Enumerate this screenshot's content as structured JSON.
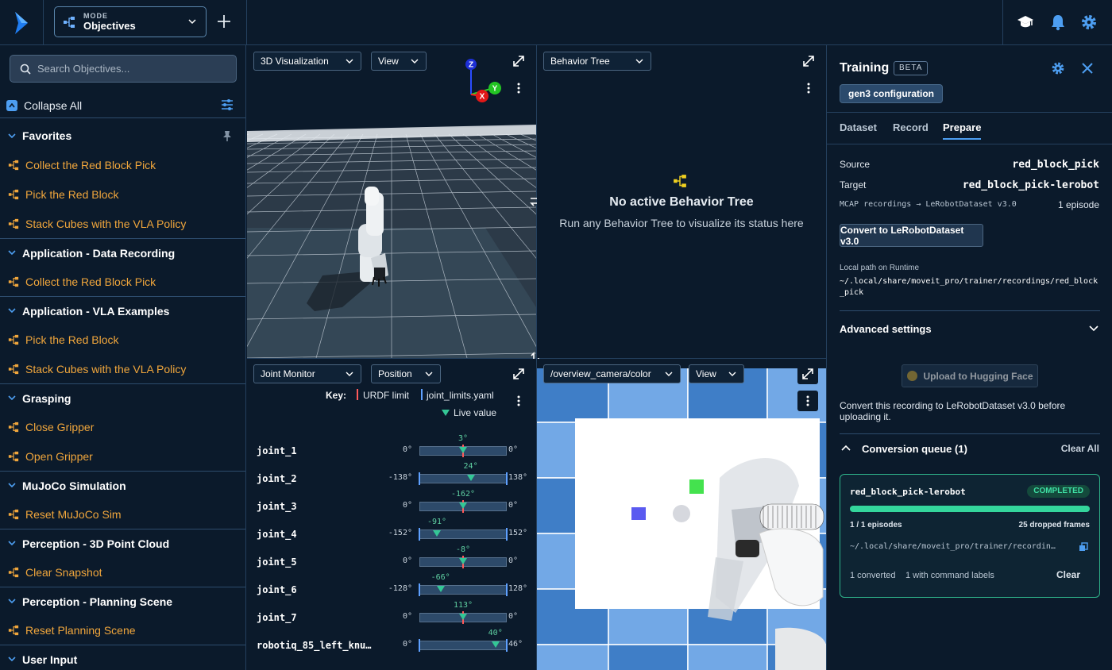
{
  "topbar": {
    "mode_label": "MODE",
    "mode_value": "Objectives"
  },
  "sidebar": {
    "search_placeholder": "Search Objectives...",
    "collapse_all": "Collapse All",
    "groups": [
      {
        "label": "Favorites",
        "items": [
          "Collect the Red Block Pick",
          "Pick the Red Block",
          "Stack Cubes with the VLA Policy"
        ]
      },
      {
        "label": "Application - Data Recording",
        "items": [
          "Collect the Red Block Pick"
        ]
      },
      {
        "label": "Application - VLA Examples",
        "items": [
          "Pick the Red Block",
          "Stack Cubes with the VLA Policy"
        ]
      },
      {
        "label": "Grasping",
        "items": [
          "Close Gripper",
          "Open Gripper"
        ]
      },
      {
        "label": "MuJoCo Simulation",
        "items": [
          "Reset MuJoCo Sim"
        ]
      },
      {
        "label": "Perception - 3D Point Cloud",
        "items": [
          "Clear Snapshot"
        ]
      },
      {
        "label": "Perception - Planning Scene",
        "items": [
          "Reset Planning Scene"
        ]
      },
      {
        "label": "User Input",
        "items": []
      }
    ]
  },
  "viz": {
    "dropdown": "3D Visualization",
    "view": "View",
    "axis_z": "Z",
    "axis_y": "Y",
    "axis_x": "X"
  },
  "bt": {
    "dropdown": "Behavior Tree",
    "title": "No active Behavior Tree",
    "subtitle": "Run any Behavior Tree to visualize its status here"
  },
  "joint_monitor": {
    "dropdown": "Joint Monitor",
    "mode": "Position",
    "key_label": "Key:",
    "urdf_limit": "URDF limit",
    "limits_yaml": "joint_limits.yaml",
    "live_value": "Live value",
    "joints": [
      {
        "name": "joint_1",
        "min": "0°",
        "max": "0°",
        "value": "3°",
        "pos": 0.5,
        "limits": false
      },
      {
        "name": "joint_2",
        "min": "-138°",
        "max": "138°",
        "value": "24°",
        "pos": 0.587,
        "limits": true
      },
      {
        "name": "joint_3",
        "min": "0°",
        "max": "0°",
        "value": "-162°",
        "pos": 0.5,
        "limits": false
      },
      {
        "name": "joint_4",
        "min": "-152°",
        "max": "152°",
        "value": "-91°",
        "pos": 0.2,
        "limits": true
      },
      {
        "name": "joint_5",
        "min": "0°",
        "max": "0°",
        "value": "-8°",
        "pos": 0.5,
        "limits": false
      },
      {
        "name": "joint_6",
        "min": "-128°",
        "max": "128°",
        "value": "-66°",
        "pos": 0.242,
        "limits": true
      },
      {
        "name": "joint_7",
        "min": "0°",
        "max": "0°",
        "value": "113°",
        "pos": 0.5,
        "limits": false
      },
      {
        "name": "robotiq_85_left_knu…",
        "min": "0°",
        "max": "46°",
        "value": "40°",
        "pos": 0.87,
        "limits": true
      }
    ]
  },
  "camera": {
    "dropdown": "/overview_camera/color",
    "view": "View"
  },
  "training": {
    "title": "Training",
    "badge": "BETA",
    "config": "gen3 configuration",
    "tabs": [
      "Dataset",
      "Record",
      "Prepare"
    ],
    "active_tab": "Prepare",
    "source_label": "Source",
    "source_value": "red_block_pick",
    "target_label": "Target",
    "target_value": "red_block_pick-lerobot",
    "conversion_desc": "MCAP recordings → LeRobotDataset v3.0",
    "episode_count": "1 episode",
    "convert_button": "Convert to LeRobotDataset v3.0",
    "local_path_label": "Local path on Runtime",
    "local_path": "~/.local/share/moveit_pro/trainer/recordings/red_block_pick",
    "advanced_settings": "Advanced settings",
    "upload_button": "Upload to Hugging Face",
    "upload_note": "Convert this recording to LeRobotDataset v3.0 before uploading it.",
    "queue_title": "Conversion queue (1)",
    "clear_all": "Clear All",
    "job": {
      "name": "red_block_pick-lerobot",
      "status": "COMPLETED",
      "progress": 1.0,
      "episodes": "1 / 1 episodes",
      "dropped": "25 dropped frames",
      "path": "~/.local/share/moveit_pro/trainer/recordin…",
      "converted": "1 converted",
      "command_labels": "1 with command labels",
      "clear": "Clear"
    }
  },
  "colors": {
    "accent": "#4d9ef1",
    "objective": "#f0a63c",
    "success": "#34c796",
    "background": "#0b1a2b"
  }
}
